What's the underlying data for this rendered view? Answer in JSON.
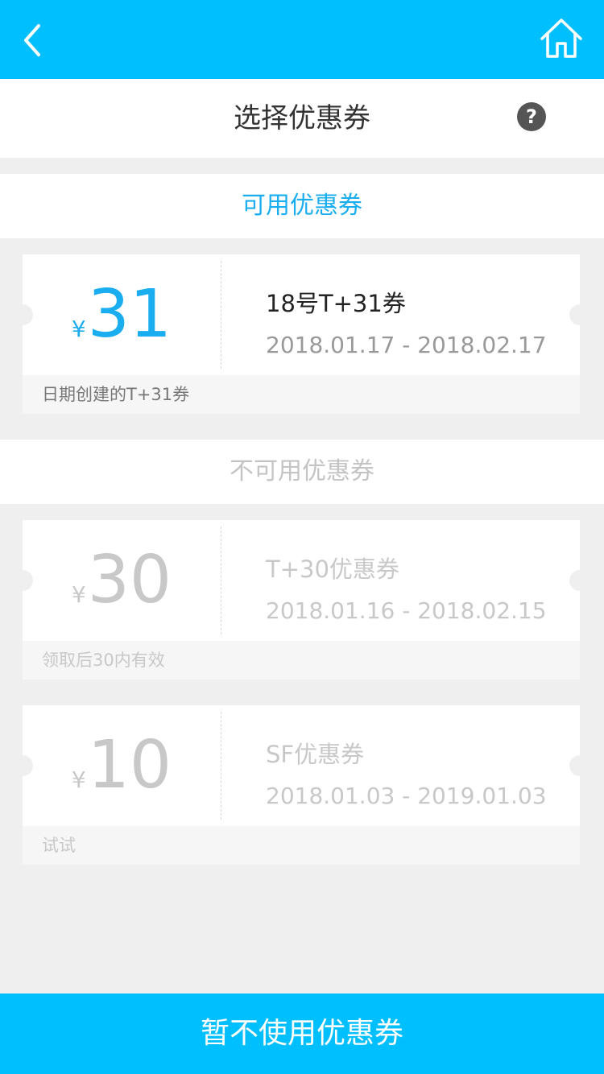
{
  "header": {
    "back_icon": "chevron-left-icon",
    "home_icon": "home-icon",
    "bg_color": "#00bfff"
  },
  "title_bar": {
    "title": "选择优惠券",
    "help_icon": "?"
  },
  "available": {
    "heading": "可用优惠券",
    "coupons": [
      {
        "currency": "¥",
        "amount": "31",
        "name": "18号T+31券",
        "dates": "2018.01.17 - 2018.02.17",
        "note": "日期创建的T+31券"
      }
    ]
  },
  "unavailable": {
    "heading": "不可用优惠券",
    "coupons": [
      {
        "currency": "¥",
        "amount": "30",
        "name": "T+30优惠券",
        "dates": "2018.01.16 - 2018.02.15",
        "note": "领取后30内有效"
      },
      {
        "currency": "¥",
        "amount": "10",
        "name": "SF优惠券",
        "dates": "2018.01.03 - 2019.01.03",
        "note": "试试"
      }
    ]
  },
  "footer": {
    "button_label": "暂不使用优惠券"
  },
  "colors": {
    "accent": "#00bfff",
    "available_text": "#1aaef0",
    "disabled_text": "#c8c8c8"
  }
}
